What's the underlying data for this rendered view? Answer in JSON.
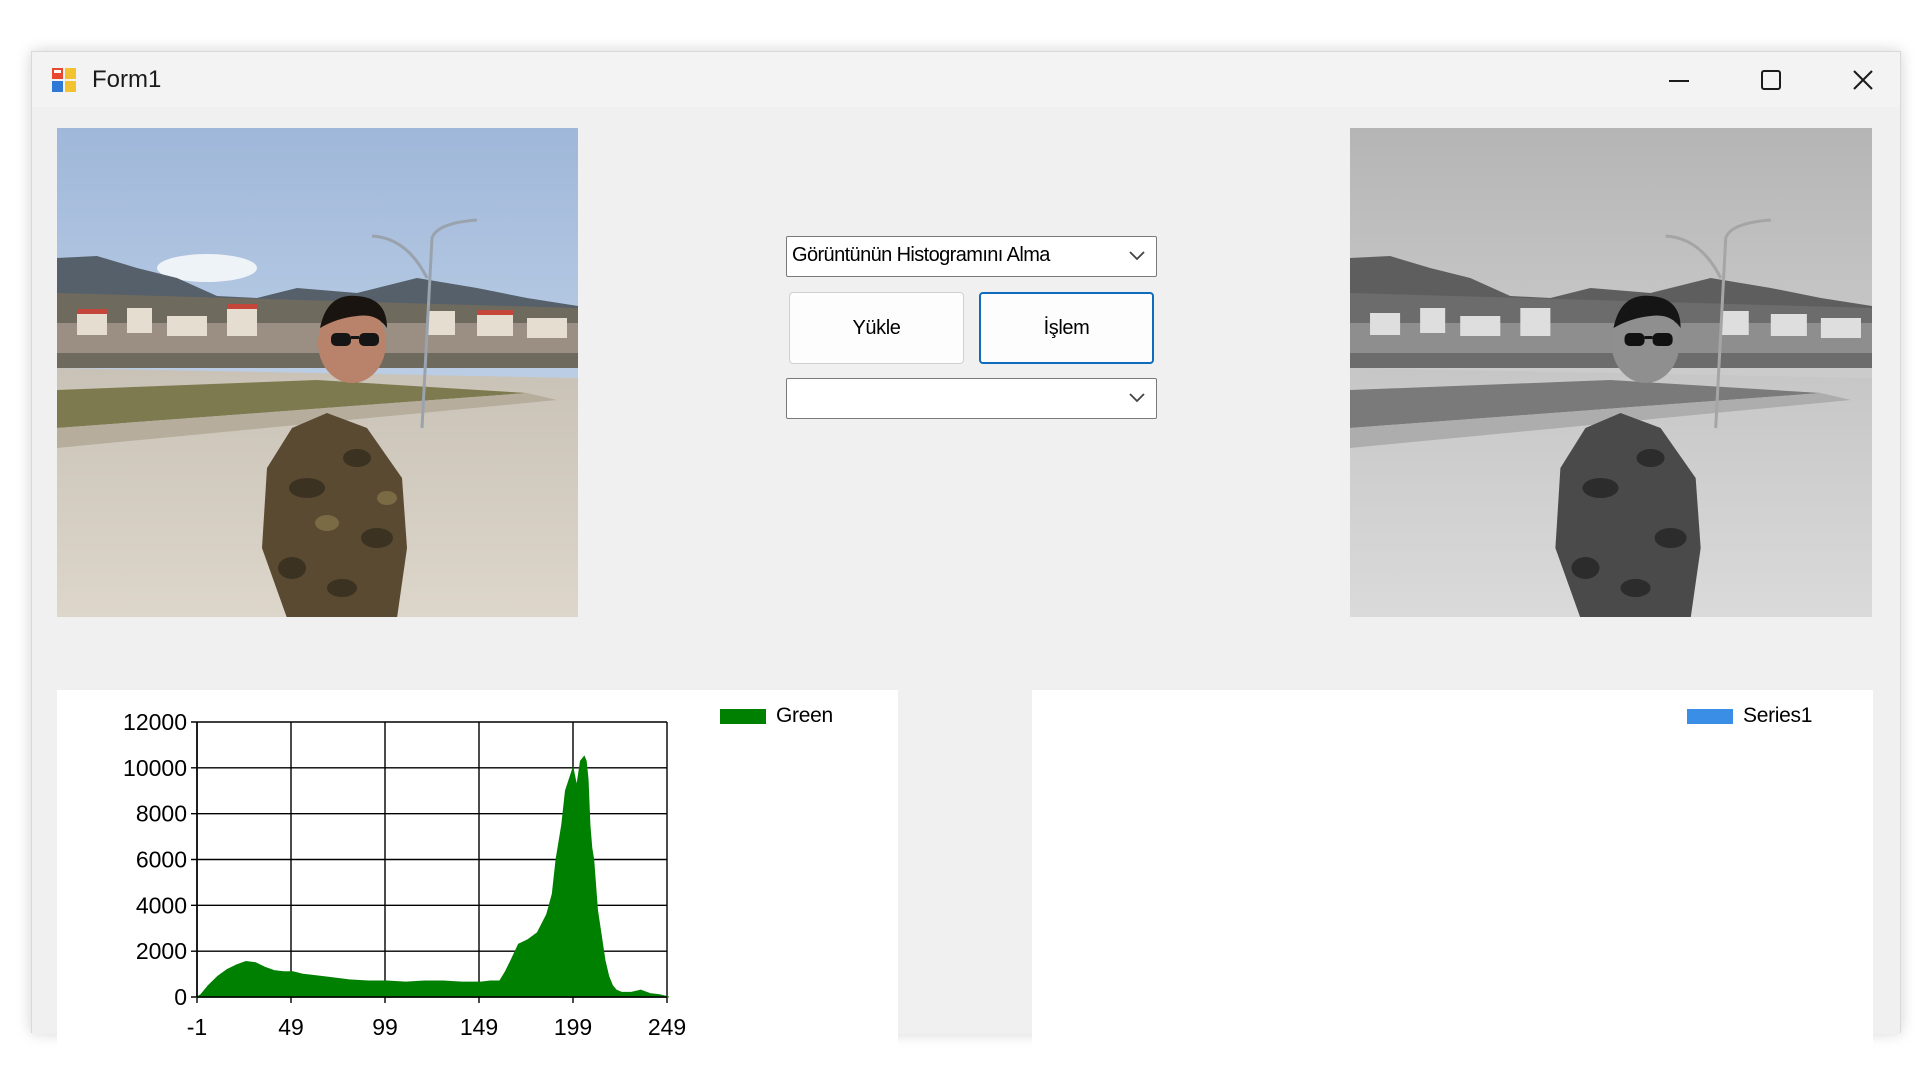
{
  "window": {
    "title": "Form1"
  },
  "controls": {
    "operation_combo_value": "Görüntünün Histogramını Alma",
    "channel_combo_value": "",
    "load_button_label": "Yükle",
    "process_button_label": "İşlem"
  },
  "images": {
    "left": "original color photo: man in camouflage jacket and sunglasses on a plaza with street lamps, hills and buildings behind, blue sky",
    "right": "same photo converted to grayscale"
  },
  "colors": {
    "green_series": "#008000",
    "series1": "#3a8ee6",
    "accent": "#0f6cbd"
  },
  "icons": [
    "app-form-icon",
    "minimize-icon",
    "maximize-icon",
    "close-icon",
    "chevron-down-icon"
  ],
  "chart_data": [
    {
      "type": "area",
      "legend_position": "top-right",
      "grid": true,
      "series": [
        {
          "name": "Green",
          "color": "#008000",
          "x": [
            -1,
            1,
            5,
            10,
            15,
            20,
            25,
            30,
            35,
            40,
            45,
            50,
            55,
            60,
            70,
            80,
            90,
            100,
            110,
            120,
            130,
            140,
            150,
            155,
            160,
            163,
            166,
            170,
            175,
            180,
            185,
            188,
            190,
            193,
            195,
            197,
            199,
            201,
            203,
            205,
            206,
            207,
            208,
            209,
            210,
            212,
            214,
            216,
            218,
            220,
            222,
            225,
            230,
            235,
            240,
            245,
            250
          ],
          "values": [
            0,
            100,
            500,
            900,
            1200,
            1400,
            1550,
            1500,
            1300,
            1150,
            1100,
            1100,
            1000,
            950,
            850,
            750,
            700,
            700,
            650,
            700,
            700,
            650,
            650,
            700,
            700,
            1100,
            1600,
            2300,
            2500,
            2800,
            3600,
            4500,
            6000,
            7500,
            9000,
            9500,
            10000,
            9200,
            10300,
            10500,
            10300,
            9500,
            7500,
            6500,
            6000,
            3800,
            2700,
            1600,
            900,
            500,
            300,
            200,
            200,
            300,
            150,
            100,
            0
          ]
        }
      ],
      "x_ticks": [
        "-1",
        "49",
        "99",
        "149",
        "199",
        "249"
      ],
      "y_ticks": [
        "0",
        "2000",
        "4000",
        "6000",
        "8000",
        "10000",
        "12000"
      ],
      "xlim": [
        -1,
        249
      ],
      "ylim": [
        0,
        12000
      ]
    },
    {
      "type": "area",
      "legend_position": "top-right",
      "grid": false,
      "series": [
        {
          "name": "Series1",
          "color": "#3a8ee6",
          "values": []
        }
      ]
    }
  ]
}
